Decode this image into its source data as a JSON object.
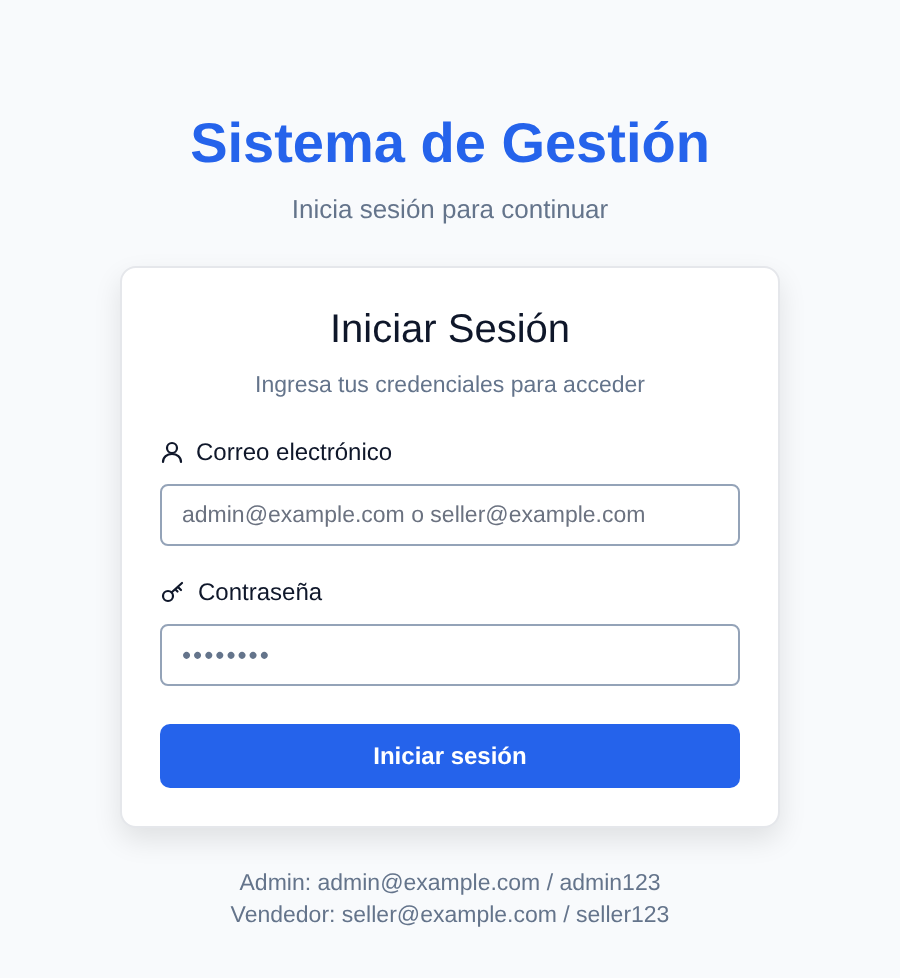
{
  "header": {
    "title": "Sistema de Gestión",
    "subtitle": "Inicia sesión para continuar"
  },
  "card": {
    "title": "Iniciar Sesión",
    "description": "Ingresa tus credenciales para acceder",
    "fields": [
      {
        "kind": "email",
        "label": "Correo electrónico",
        "placeholder": "admin@example.com o seller@example.com"
      },
      {
        "kind": "password",
        "label": "Contraseña",
        "value": "••••••••"
      }
    ],
    "submit": "Iniciar sesión"
  },
  "credentials": [
    "Admin: admin@example.com / admin123",
    "Vendedor: seller@example.com / seller123"
  ]
}
